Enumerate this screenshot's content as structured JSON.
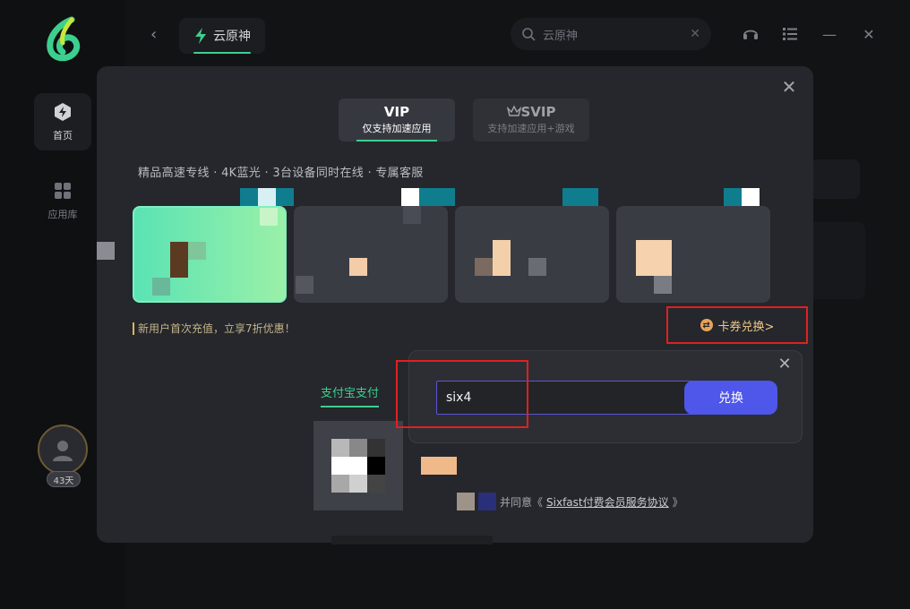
{
  "sidebar": {
    "items": [
      {
        "label": "首页",
        "icon": "lightning-icon",
        "active": true
      },
      {
        "label": "应用库",
        "icon": "grid-icon",
        "active": false
      }
    ],
    "user": {
      "days_badge": "43天"
    }
  },
  "topbar": {
    "app_tab_label": "云原神",
    "search_placeholder": "云原神",
    "icons": [
      "back-icon",
      "headset-icon",
      "list-icon",
      "minimize-icon",
      "close-icon"
    ]
  },
  "modal": {
    "tabs": [
      {
        "title": "VIP",
        "subtitle": "仅支持加速应用",
        "active": true
      },
      {
        "title": "SVIP",
        "subtitle": "支持加速应用+游戏",
        "active": false
      }
    ],
    "perks_text": "精品高速专线 · 4K蓝光 · 3台设备同时在线 · 专属客服",
    "promo_text": "新用户首次充值，立享7折优惠！",
    "coupon_link": "卡券兑换>",
    "payment_method": "支付宝支付",
    "agreement": {
      "prefix": "并同意《",
      "link": "Sixfast付费会员服务协议",
      "suffix": "》"
    }
  },
  "coupon_popup": {
    "code_value": "six4",
    "redeem_label": "兑换"
  },
  "colors": {
    "accent_green": "#3ccf8e",
    "redeem_blue": "#4f56ea",
    "highlight_red": "#e02020",
    "coupon_orange": "#ecc98a"
  }
}
